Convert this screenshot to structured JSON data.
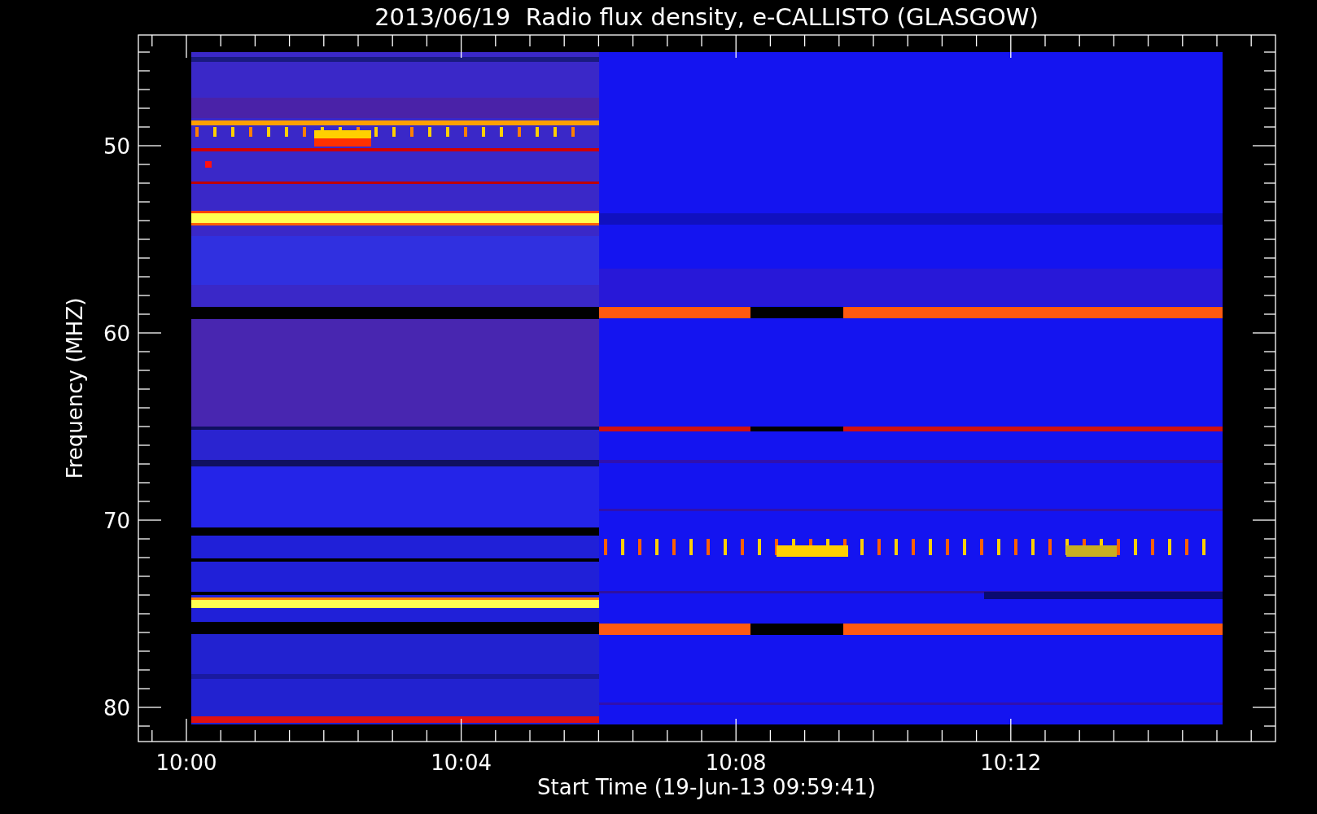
{
  "title": "2013/06/19  Radio flux density, e-CALLISTO (GLASGOW)",
  "y_axis": {
    "label": "Frequency (MHZ)",
    "ticks": [
      "50",
      "60",
      "70",
      "80"
    ]
  },
  "x_axis": {
    "label": "Start Time (19-Jun-13 09:59:41)",
    "ticks": [
      "10:00",
      "10:04",
      "10:08",
      "10:12"
    ]
  }
}
